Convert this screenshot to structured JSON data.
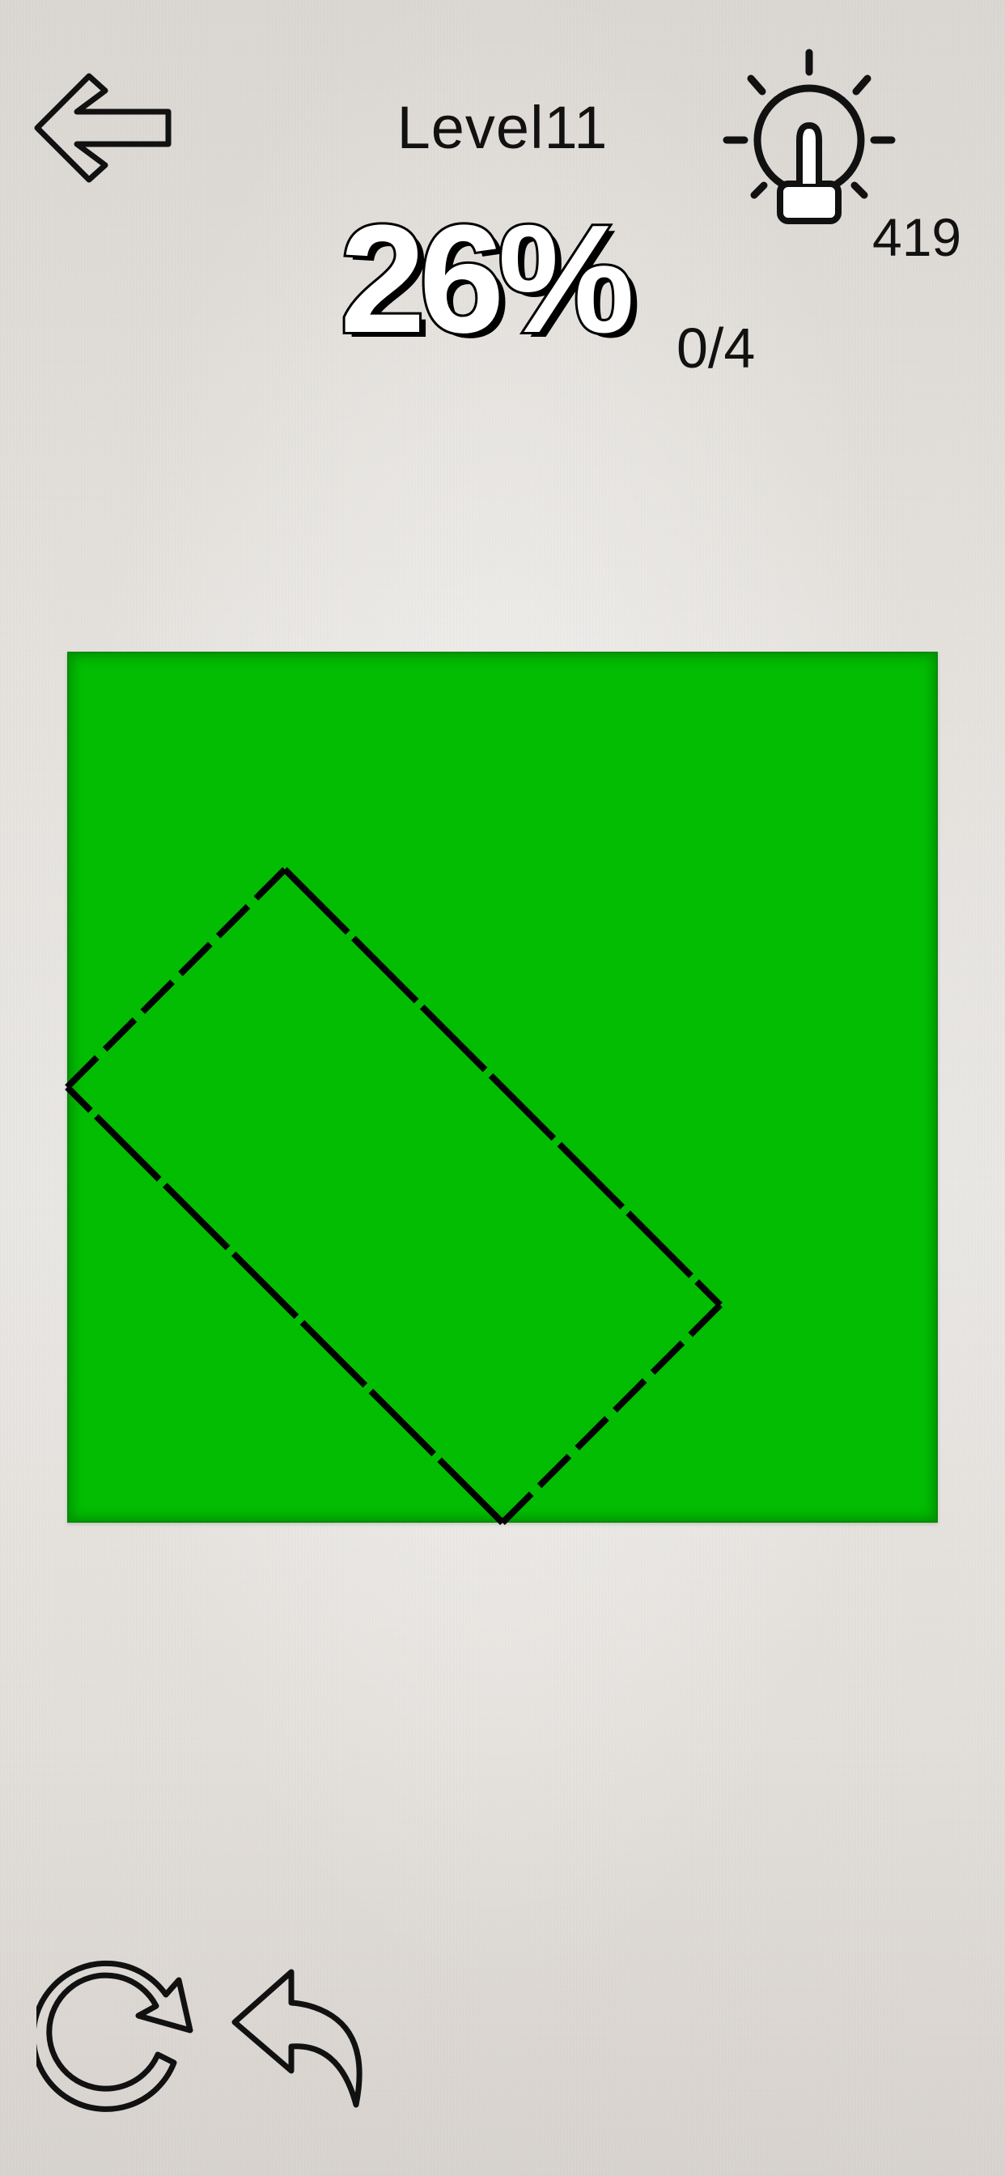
{
  "header": {
    "back_icon": "arrow-left-icon",
    "level_label": "Level11",
    "hint_icon": "lightbulb-icon",
    "hint_count": "419"
  },
  "progress": {
    "percent_text": "26%",
    "cuts_text": "0/4"
  },
  "board": {
    "fill_color": "#02bd02",
    "line_color": "#000000"
  },
  "controls": {
    "redo_icon": "redo-icon",
    "undo_icon": "undo-icon"
  }
}
